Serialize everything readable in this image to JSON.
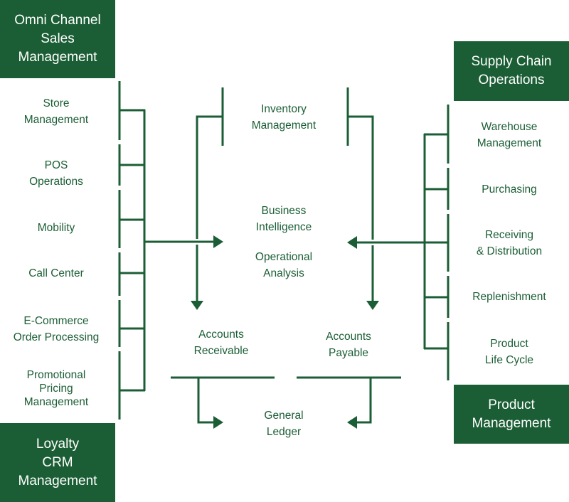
{
  "colors": {
    "accent": "#1b5e35",
    "background": "#ffffff",
    "box_text": "#ffffff"
  },
  "boxes": {
    "omni_channel": [
      "Omni Channel",
      "Sales",
      "Management"
    ],
    "loyalty": [
      "Loyalty",
      "CRM",
      "Management"
    ],
    "supply_chain": [
      "Supply Chain",
      "Operations"
    ],
    "product_management": [
      "Product",
      "Management"
    ]
  },
  "left_items": [
    [
      "Store",
      "Management"
    ],
    [
      "POS",
      "Operations"
    ],
    [
      "Mobility"
    ],
    [
      "Call Center"
    ],
    [
      "E-Commerce",
      "Order Processing"
    ],
    [
      "Promotional",
      "Pricing",
      "Management"
    ]
  ],
  "right_items": [
    [
      "Warehouse",
      "Management"
    ],
    [
      "Purchasing"
    ],
    [
      "Receiving",
      "& Distribution"
    ],
    [
      "Replenishment"
    ],
    [
      "Product",
      "Life Cycle"
    ]
  ],
  "center": {
    "inventory": [
      "Inventory",
      "Management"
    ],
    "business_intelligence": [
      "Business",
      "Intelligence"
    ],
    "operational_analysis": [
      "Operational",
      "Analysis"
    ],
    "accounts_receivable": [
      "Accounts",
      "Receivable"
    ],
    "accounts_payable": [
      "Accounts",
      "Payable"
    ],
    "general_ledger": [
      "General",
      "Ledger"
    ]
  }
}
